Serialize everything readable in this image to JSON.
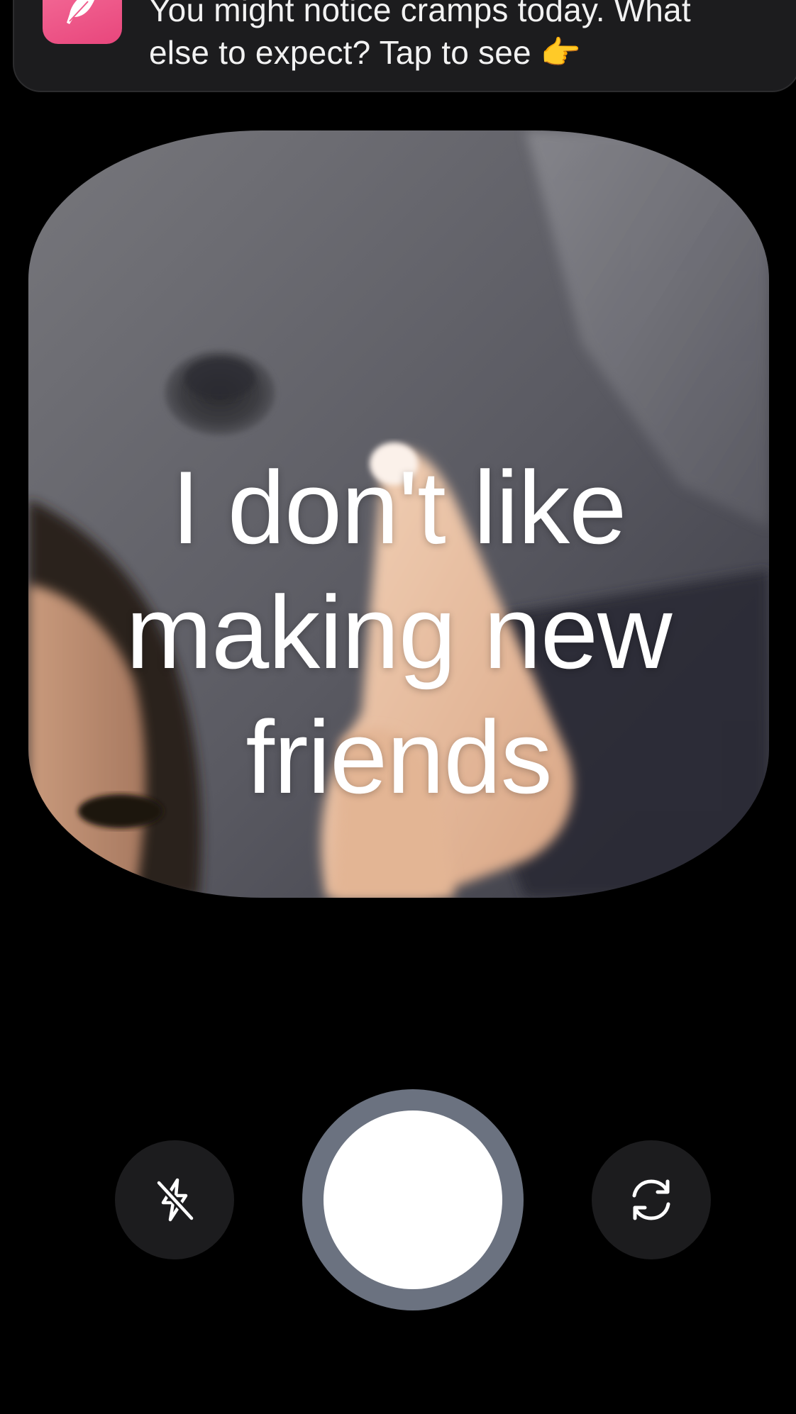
{
  "notification": {
    "app_icon": "feather-icon",
    "app_icon_color": "#ef5b8b",
    "line1": "You might notice cramps today. What",
    "line2": "else to expect? Tap to see 👉"
  },
  "prompt": {
    "line1": "I don't like",
    "line2": "making new",
    "line3": "friends"
  },
  "controls": {
    "flash_icon": "flash-off-icon",
    "shutter_icon": "shutter-icon",
    "flip_icon": "camera-flip-icon"
  },
  "colors": {
    "background": "#000000",
    "control_bg": "#1c1c1e",
    "shutter_ring": "#6b7280",
    "shutter_fill": "#ffffff"
  }
}
